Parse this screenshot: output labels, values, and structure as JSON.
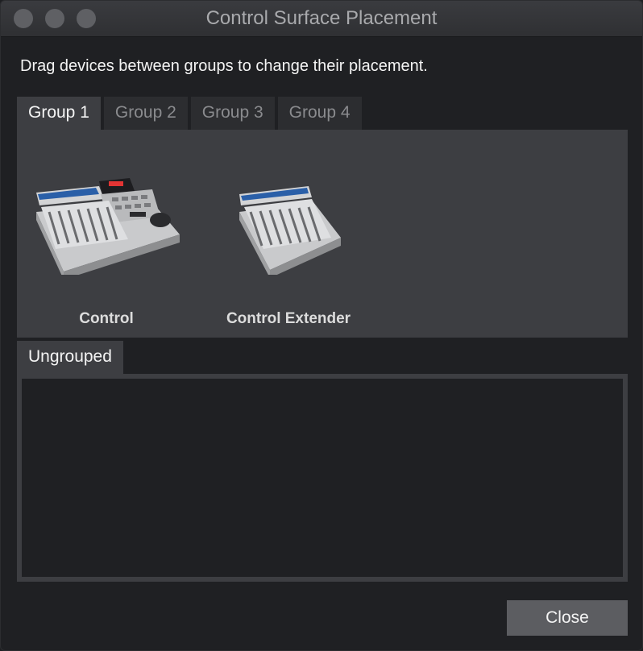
{
  "window": {
    "title": "Control Surface Placement"
  },
  "instruction": "Drag devices between groups to change their placement.",
  "tabs": [
    {
      "label": "Group 1",
      "active": true
    },
    {
      "label": "Group 2",
      "active": false
    },
    {
      "label": "Group 3",
      "active": false
    },
    {
      "label": "Group 4",
      "active": false
    }
  ],
  "devices": [
    {
      "label": "Control",
      "icon": "control-surface-icon"
    },
    {
      "label": "Control Extender",
      "icon": "control-extender-icon"
    }
  ],
  "ungrouped": {
    "label": "Ungrouped"
  },
  "buttons": {
    "close_label": "Close"
  },
  "colors": {
    "window_bg": "#1f2023",
    "panel_bg": "#3d3e42",
    "button_bg": "#5c5d61"
  }
}
